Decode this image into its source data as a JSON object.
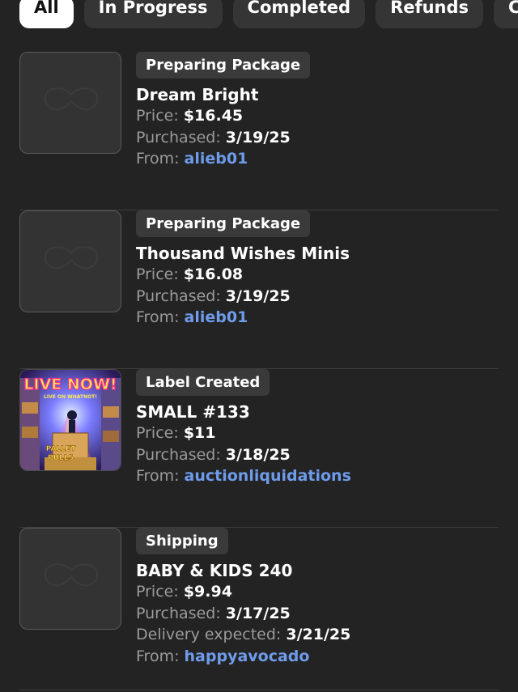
{
  "tabs": [
    {
      "label": "All",
      "active": true
    },
    {
      "label": "In Progress",
      "active": false
    },
    {
      "label": "Completed",
      "active": false
    },
    {
      "label": "Refunds",
      "active": false
    },
    {
      "label": "Canc",
      "active": false
    }
  ],
  "orders": [
    {
      "status": "Preparing Package",
      "title": "Dream Bright",
      "price_label": "Price:",
      "price": "$16.45",
      "purchased_label": "Purchased:",
      "purchased": "3/19/25",
      "from_label": "From:",
      "seller": "alieb01",
      "thumbnail": "placeholder-icon"
    },
    {
      "status": "Preparing Package",
      "title": "Thousand Wishes Minis",
      "price_label": "Price:",
      "price": "$16.08",
      "purchased_label": "Purchased:",
      "purchased": "3/19/25",
      "from_label": "From:",
      "seller": "alieb01",
      "thumbnail": "placeholder-icon"
    },
    {
      "status": "Label Created",
      "title": "SMALL #133",
      "price_label": "Price:",
      "price": "$11",
      "purchased_label": "Purchased:",
      "purchased": "3/18/25",
      "from_label": "From:",
      "seller": "auctionliquidations",
      "thumbnail": "live-now-image",
      "thumb_text": {
        "live": "LIVE NOW!",
        "sub": "LIVE ON WHATNOT!",
        "pallet": "PALLET",
        "pulls": "PULLS"
      }
    },
    {
      "status": "Shipping",
      "title": "BABY & KIDS 240",
      "price_label": "Price:",
      "price": "$9.94",
      "purchased_label": "Purchased:",
      "purchased": "3/17/25",
      "delivery_label": "Delivery expected:",
      "delivery": "3/21/25",
      "from_label": "From:",
      "seller": "happyavocado",
      "thumbnail": "placeholder-icon"
    }
  ],
  "colors": {
    "background": "#232323",
    "tab_bg": "#353535",
    "tab_active_bg": "#ffffff",
    "badge_bg": "#3a3a3a",
    "muted_text": "#9b9b9b",
    "link": "#6e9bea"
  }
}
